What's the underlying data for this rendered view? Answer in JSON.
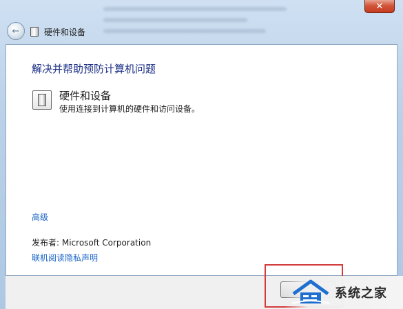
{
  "window": {
    "close_label": "✕"
  },
  "nav": {
    "back_arrow": "←",
    "title": "硬件和设备"
  },
  "content": {
    "heading": "解决并帮助预防计算机问题",
    "item": {
      "title": "硬件和设备",
      "description": "使用连接到计算机的硬件和访问设备。"
    },
    "advanced_link": "高级",
    "publisher": "发布者:  Microsoft Corporation",
    "privacy_link": "联机阅读隐私声明"
  },
  "watermark": {
    "text": "系统之家"
  },
  "colors": {
    "heading": "#1e3287",
    "link": "#1a64c8",
    "highlight": "#d43a3a",
    "close_button": "#c43c1f"
  }
}
